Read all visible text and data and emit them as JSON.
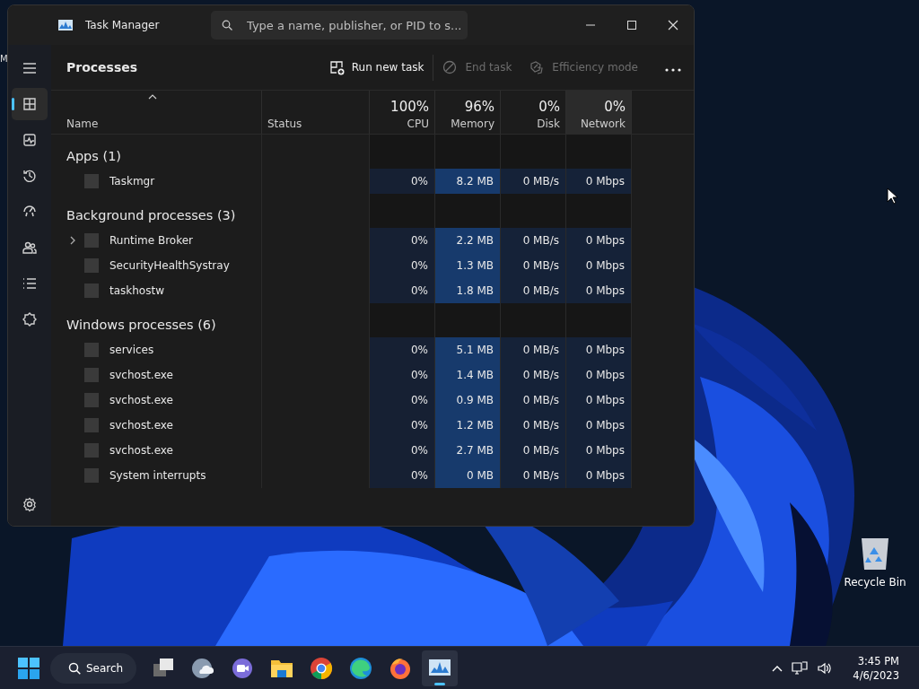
{
  "desktop": {
    "icons": [
      {
        "kind": "hidden",
        "label": "M"
      },
      {
        "kind": "recycle",
        "label": "Recycle Bin"
      }
    ]
  },
  "window": {
    "title": "Task Manager",
    "search": {
      "placeholder": "Type a name, publisher, or PID to s..."
    }
  },
  "sidebar": {
    "items": [
      {
        "kind": "menu",
        "selected": false
      },
      {
        "kind": "processes",
        "selected": true
      },
      {
        "kind": "performance",
        "selected": false
      },
      {
        "kind": "history",
        "selected": false
      },
      {
        "kind": "startup",
        "selected": false
      },
      {
        "kind": "users",
        "selected": false
      },
      {
        "kind": "details",
        "selected": false
      },
      {
        "kind": "services",
        "selected": false
      },
      {
        "kind": "settings",
        "selected": false
      }
    ]
  },
  "toolbar": {
    "title": "Processes",
    "actions": [
      {
        "kind": "run",
        "label": "Run new task",
        "disabled": false
      },
      {
        "kind": "end",
        "label": "End task",
        "disabled": true
      },
      {
        "kind": "efficiency",
        "label": "Efficiency mode",
        "disabled": true
      }
    ]
  },
  "table": {
    "columns": [
      {
        "label": "Name",
        "hovered": false
      },
      {
        "label": "Status",
        "hovered": false
      },
      {
        "label": "CPU",
        "total": "100%",
        "hovered": false
      },
      {
        "label": "Memory",
        "total": "96%",
        "hovered": false
      },
      {
        "label": "Disk",
        "total": "0%",
        "hovered": false
      },
      {
        "label": "Network",
        "total": "0%",
        "hovered": true
      }
    ],
    "groups": [
      {
        "title": "Apps (1)",
        "rows": [
          {
            "name": "Taskmgr",
            "expandable": false,
            "cells": [
              "0%",
              "8.2 MB",
              "0 MB/s",
              "0 Mbps"
            ]
          }
        ]
      },
      {
        "title": "Background processes (3)",
        "rows": [
          {
            "name": "Runtime Broker",
            "expandable": true,
            "cells": [
              "0%",
              "2.2 MB",
              "0 MB/s",
              "0 Mbps"
            ]
          },
          {
            "name": "SecurityHealthSystray",
            "expandable": false,
            "cells": [
              "0%",
              "1.3 MB",
              "0 MB/s",
              "0 Mbps"
            ]
          },
          {
            "name": "taskhostw",
            "expandable": false,
            "cells": [
              "0%",
              "1.8 MB",
              "0 MB/s",
              "0 Mbps"
            ]
          }
        ]
      },
      {
        "title": "Windows processes (6)",
        "rows": [
          {
            "name": "services",
            "expandable": false,
            "cells": [
              "0%",
              "5.1 MB",
              "0 MB/s",
              "0 Mbps"
            ]
          },
          {
            "name": "svchost.exe",
            "expandable": false,
            "cells": [
              "0%",
              "1.4 MB",
              "0 MB/s",
              "0 Mbps"
            ]
          },
          {
            "name": "svchost.exe",
            "expandable": false,
            "cells": [
              "0%",
              "0.9 MB",
              "0 MB/s",
              "0 Mbps"
            ]
          },
          {
            "name": "svchost.exe",
            "expandable": false,
            "cells": [
              "0%",
              "1.2 MB",
              "0 MB/s",
              "0 Mbps"
            ]
          },
          {
            "name": "svchost.exe",
            "expandable": false,
            "cells": [
              "0%",
              "2.7 MB",
              "0 MB/s",
              "0 Mbps"
            ]
          },
          {
            "name": "System interrupts",
            "expandable": false,
            "cells": [
              "0%",
              "0 MB",
              "0 MB/s",
              "0 Mbps"
            ]
          }
        ]
      }
    ]
  },
  "taskbar": {
    "search_label": "Search",
    "apps": [
      {
        "kind": "start",
        "active": false
      },
      {
        "kind": "taskview",
        "active": false
      },
      {
        "kind": "widgets",
        "active": false
      },
      {
        "kind": "chat",
        "active": false
      },
      {
        "kind": "files",
        "active": false
      },
      {
        "kind": "ring",
        "active": false
      },
      {
        "kind": "wave",
        "active": false
      },
      {
        "kind": "fox",
        "active": false
      },
      {
        "kind": "monitor",
        "active": true
      }
    ],
    "time": "3:45 PM",
    "date": "4/6/2023"
  }
}
